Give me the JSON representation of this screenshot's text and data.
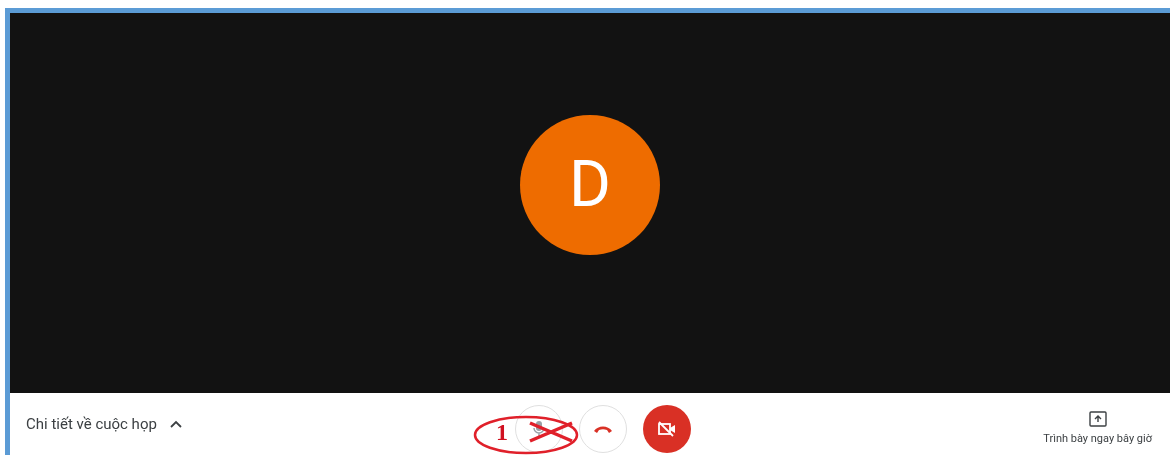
{
  "participant": {
    "initial": "D",
    "color": "#ee6c00"
  },
  "bottom_bar": {
    "details": {
      "label": "Chi tiết về cuộc họp",
      "expanded": false
    },
    "camera_on": false,
    "annotation": {
      "label": "1"
    },
    "present": {
      "label": "Trình bày ngay bây giờ"
    }
  }
}
